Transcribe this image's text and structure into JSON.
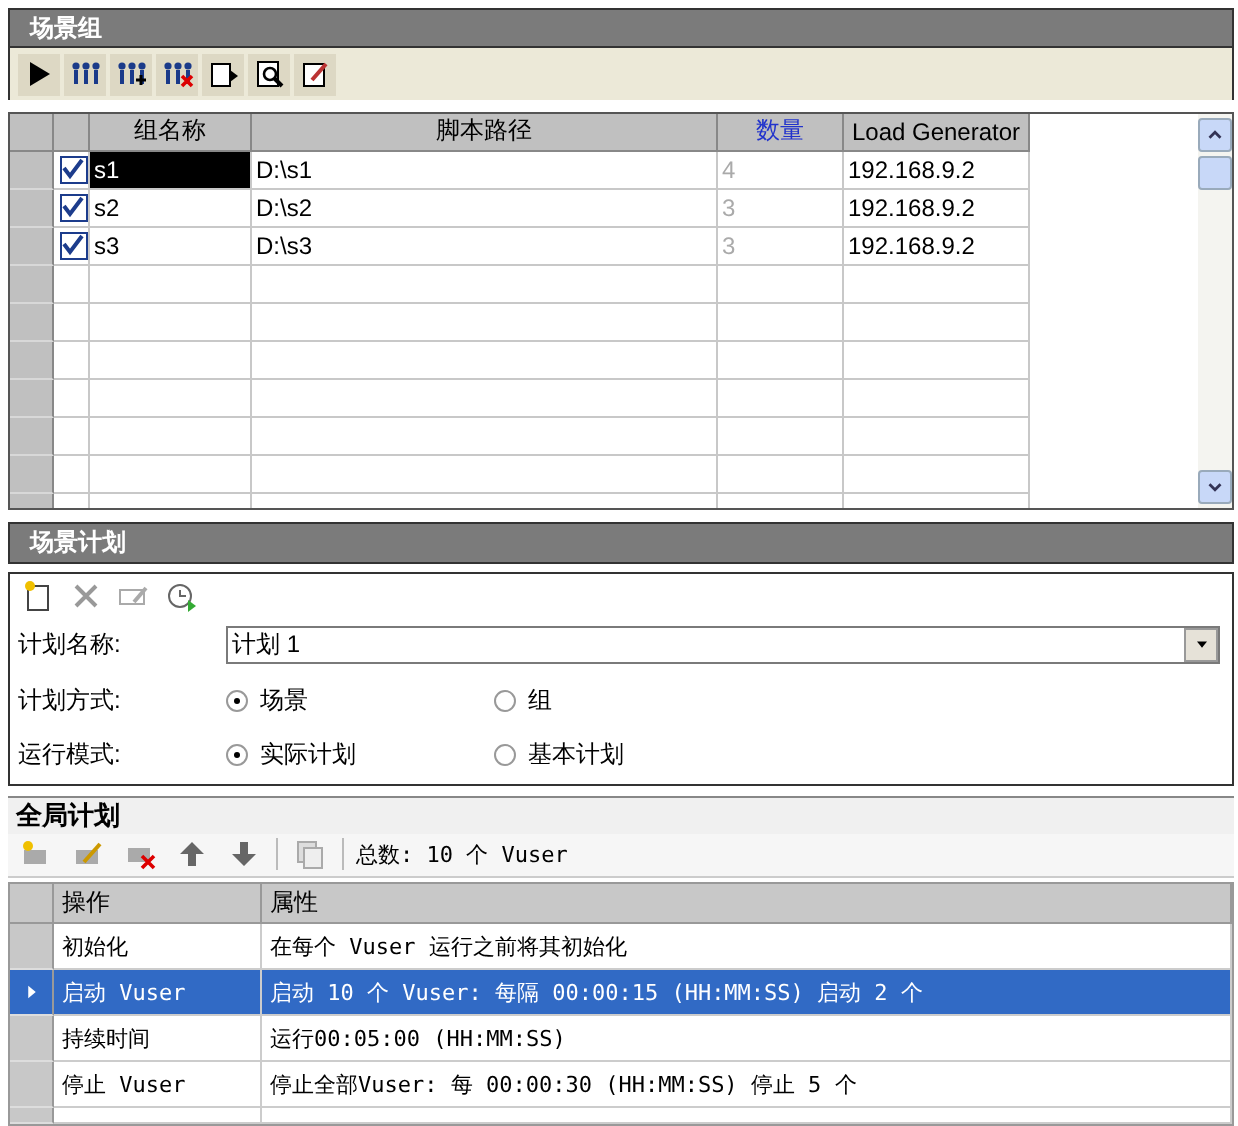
{
  "scenario_groups": {
    "title": "场景组",
    "columns": [
      "组名称",
      "脚本路径",
      "数量",
      "Load Generator"
    ],
    "rows": [
      {
        "checked": true,
        "selected": true,
        "name": "s1",
        "script_path": "D:\\s1",
        "quantity": "4",
        "load_generator": "192.168.9.2"
      },
      {
        "checked": true,
        "selected": false,
        "name": "s2",
        "script_path": "D:\\s2",
        "quantity": "3",
        "load_generator": "192.168.9.2"
      },
      {
        "checked": true,
        "selected": false,
        "name": "s3",
        "script_path": "D:\\s3",
        "quantity": "3",
        "load_generator": "192.168.9.2"
      }
    ]
  },
  "scenario_schedule": {
    "title": "场景计划",
    "name_label": "计划名称:",
    "name_value": "计划 1",
    "fields": [
      {
        "label": "计划方式:",
        "options": [
          {
            "label": "场景",
            "selected": true
          },
          {
            "label": "组",
            "selected": false
          }
        ]
      },
      {
        "label": "运行模式:",
        "options": [
          {
            "label": "实际计划",
            "selected": true
          },
          {
            "label": "基本计划",
            "selected": false
          }
        ]
      }
    ]
  },
  "global_schedule": {
    "title": "全局计划",
    "total": "总数: 10 个 Vuser",
    "columns": [
      "操作",
      "属性"
    ],
    "rows": [
      {
        "action": "初始化",
        "property": "在每个 Vuser 运行之前将其初始化",
        "selected": false
      },
      {
        "action": "启动 Vuser",
        "property": "启动 10 个 Vuser: 每隔 00:00:15 (HH:MM:SS) 启动 2 个",
        "selected": true
      },
      {
        "action": "持续时间",
        "property": "运行00:05:00 (HH:MM:SS)",
        "selected": false
      },
      {
        "action": "停止 Vuser",
        "property": "停止全部Vuser: 每 00:00:30 (HH:MM:SS) 停止 5 个",
        "selected": false
      }
    ]
  }
}
